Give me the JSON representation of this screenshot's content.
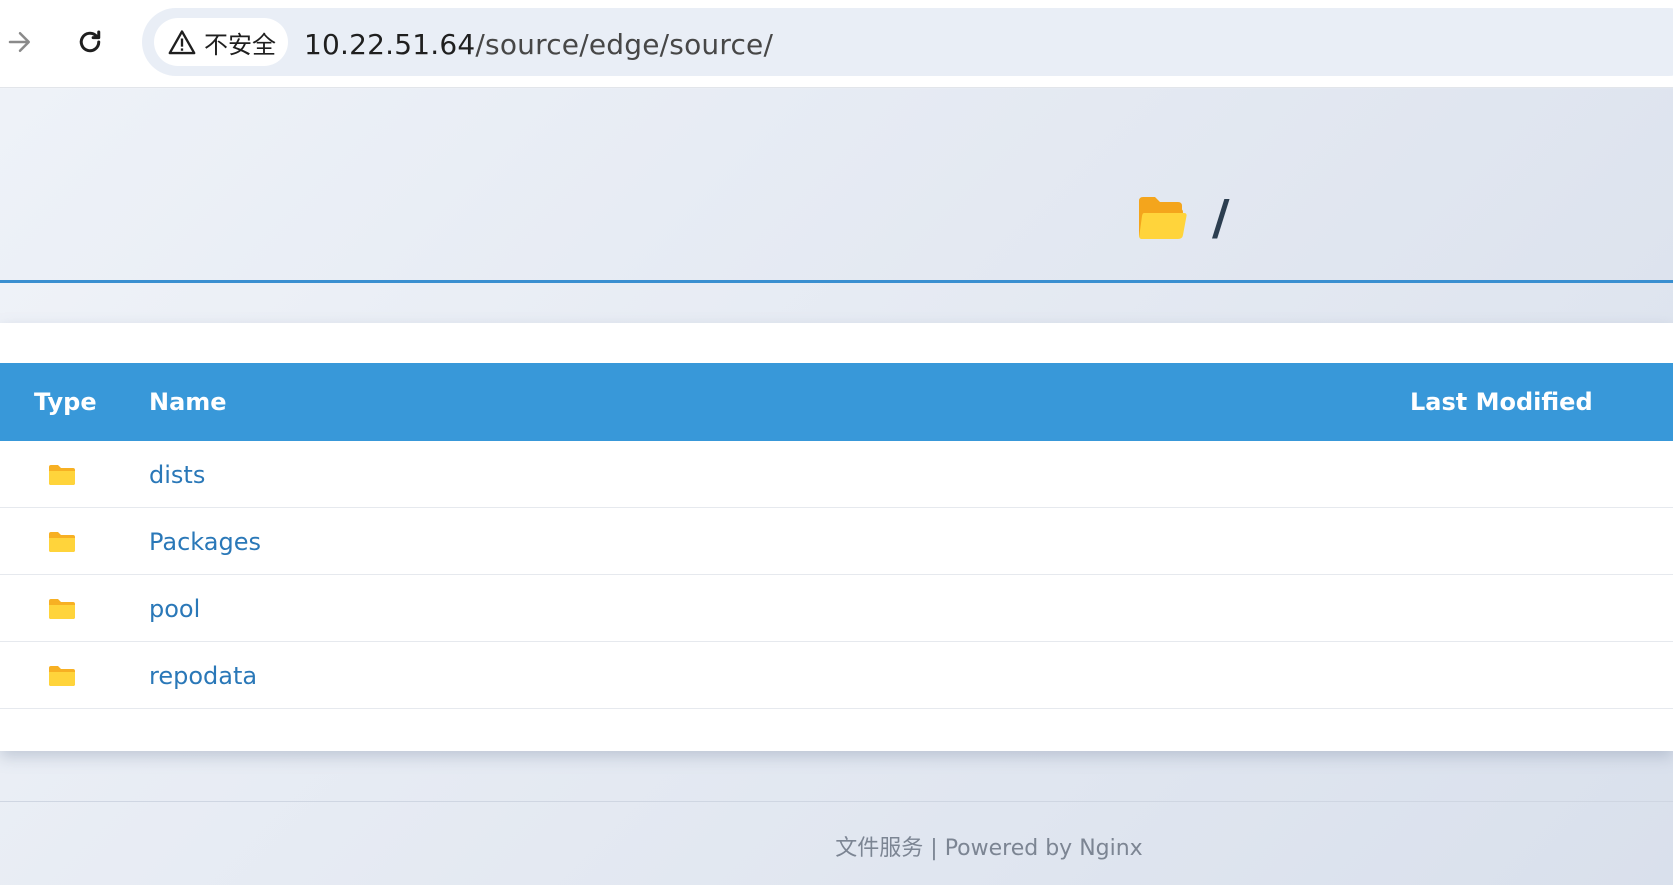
{
  "browser": {
    "security_label": "不安全",
    "url_host": "10.22.51.64",
    "url_path": "/source/edge/source/"
  },
  "header": {
    "title": "/"
  },
  "table": {
    "headers": {
      "type": "Type",
      "name": "Name",
      "last_modified": "Last Modified"
    },
    "rows": [
      {
        "type": "folder",
        "name": "dists",
        "last_modified": ""
      },
      {
        "type": "folder",
        "name": "Packages",
        "last_modified": ""
      },
      {
        "type": "folder",
        "name": "pool",
        "last_modified": ""
      },
      {
        "type": "folder",
        "name": "repodata",
        "last_modified": ""
      }
    ]
  },
  "footer": {
    "text": "文件服务 | Powered by Nginx"
  },
  "colors": {
    "accent": "#3898d9",
    "link": "#2a78b8",
    "folder": "#ffc93c"
  }
}
